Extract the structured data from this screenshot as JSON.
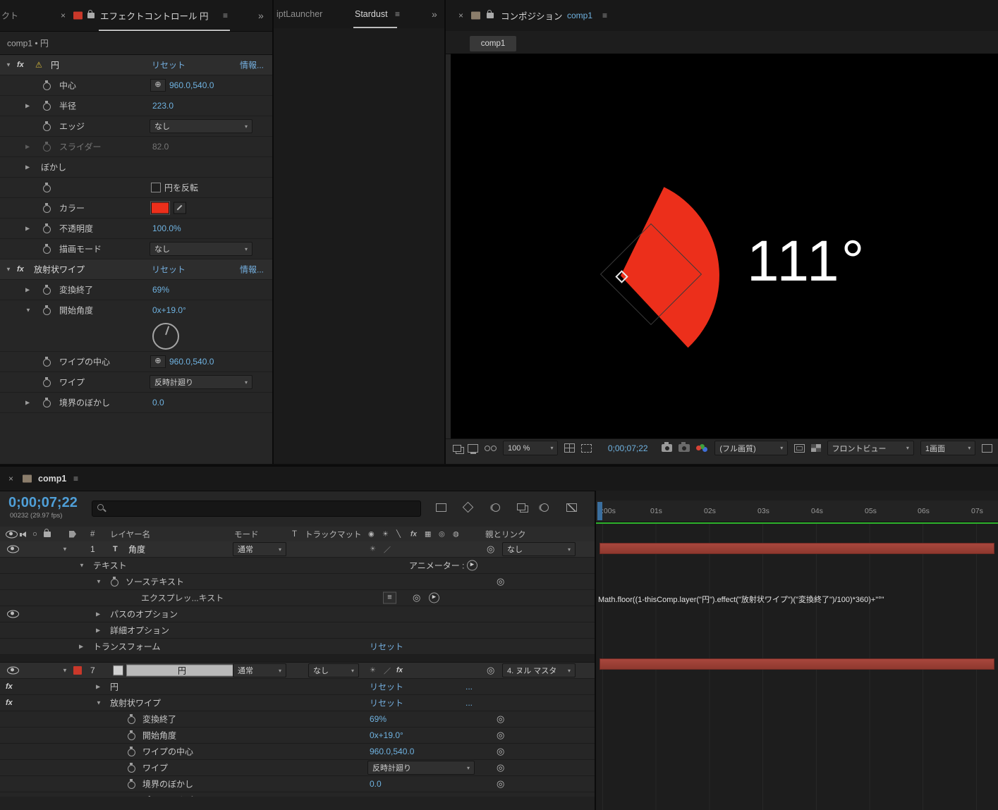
{
  "colors": {
    "accent_blue": "#6fb2e0",
    "timecode_blue": "#4f9fd8",
    "red_fill": "#ec2f1b",
    "bar_red": "#a8463d",
    "cache_green": "#2eb32c"
  },
  "icons": {
    "close": "×",
    "menu": "≡",
    "overflow": "»",
    "collapse": "▼",
    "expand": "▶",
    "dropdown": "▾",
    "warning": "⚠",
    "fx": "fx",
    "target": "⊕",
    "pickwhip": "◎",
    "play": "▶",
    "dots": "...",
    "quality": "☀",
    "draft": "／",
    "equals": "≡",
    "plus_minus": "＋－",
    "solo": "○",
    "switches": [
      "◉",
      "☀",
      "╲",
      "fx",
      "▦",
      "◎",
      "◍"
    ]
  },
  "effect_panel": {
    "partial_tab": "クト",
    "title": "エフェクトコントロール 円",
    "breadcrumb": "comp1 • 円",
    "reset": "リセット",
    "info": "情報...",
    "circle": {
      "name": "円",
      "center_label": "中心",
      "center_value": "960.0,540.0",
      "radius_label": "半径",
      "radius_value": "223.0",
      "edge_label": "エッジ",
      "edge_value": "なし",
      "slider_label": "スライダー",
      "slider_value": "82.0",
      "blur_label": "ぼかし",
      "invert_label": "円を反転",
      "color_label": "カラー",
      "opacity_label": "不透明度",
      "opacity_value": "100.0%",
      "blend_label": "描画モード",
      "blend_value": "なし"
    },
    "wipe": {
      "name": "放射状ワイプ",
      "transition_label": "変換終了",
      "transition_value": "69%",
      "angle_label": "開始角度",
      "angle_value": "0x+19.0°",
      "center_label": "ワイプの中心",
      "center_value": "960.0,540.0",
      "wipe_label": "ワイプ",
      "wipe_value": "反時計廻り",
      "feather_label": "境界のぼかし",
      "feather_value": "0.0"
    }
  },
  "script_panel": {
    "tab_inactive": "iptLauncher",
    "tab_active": "Stardust"
  },
  "comp_panel": {
    "title": "コンポジション",
    "comp_name": "comp1",
    "tab": "comp1",
    "overlay": "111°",
    "zoom": "100 %",
    "timecode": "0;00;07;22",
    "quality": "(フル画質)",
    "view": "フロントビュー",
    "layout": "1画面"
  },
  "timeline": {
    "tab": "comp1",
    "timecode": "0;00;07;22",
    "frame_info": "00232 (29.97 fps)",
    "ruler": [
      ":00s",
      "01s",
      "02s",
      "03s",
      "04s",
      "05s",
      "06s",
      "07s"
    ],
    "headers": {
      "hash": "#",
      "layer": "レイヤー名",
      "mode": "モード",
      "t": "T",
      "matte": "トラックマット",
      "parent": "親とリンク"
    },
    "r1": {
      "num": "1",
      "icon": "T",
      "name": "角度",
      "mode": "通常",
      "parent": "なし"
    },
    "text_group": "テキスト",
    "animator": "アニメーター :",
    "source_text": "ソーステキスト",
    "expression_name": "エクスプレッ...キスト",
    "expression": "Math.floor((1-thisComp.layer(\"円\").effect(\"放射状ワイプ\")(\"変換終了\")/100)*360)+\"°\"",
    "path_options": "パスのオプション",
    "advanced_options": "詳細オプション",
    "transform": "トランスフォーム",
    "reset": "リセット",
    "r7": {
      "num": "7",
      "name": "円",
      "mode": "通常",
      "matte": "なし",
      "parent": "4. ヌル マスタ"
    },
    "fx_circle": "円",
    "fx_wipe": "放射状ワイプ",
    "p_transition": {
      "label": "変換終了",
      "value": "69%"
    },
    "p_angle": {
      "label": "開始角度",
      "value": "0x+19.0°"
    },
    "p_center": {
      "label": "ワイプの中心",
      "value": "960.0,540.0"
    },
    "p_wipe": {
      "label": "ワイプ",
      "value": "反時計廻り"
    },
    "p_feather": {
      "label": "境界のぼかし",
      "value": "0.0"
    },
    "composite_options": "コンポジットオプション"
  }
}
